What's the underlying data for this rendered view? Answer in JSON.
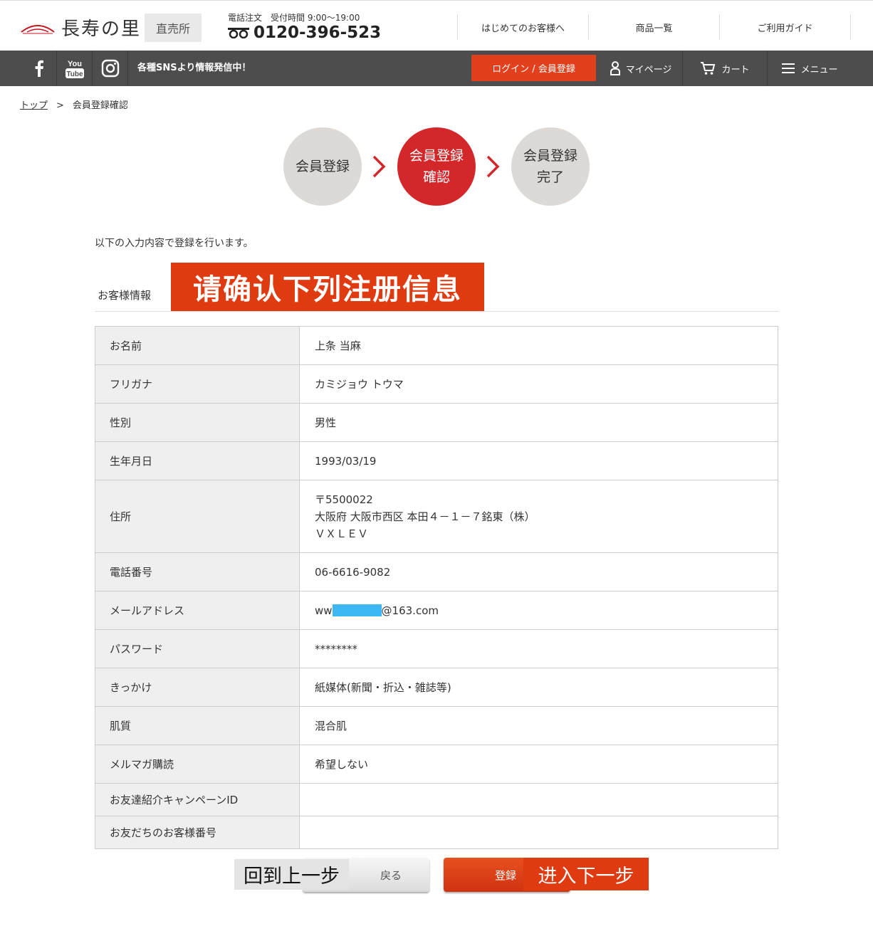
{
  "header": {
    "logo_text": "長寿の里",
    "logo_tag": "直売所",
    "phone_label": "電話注文　受付時間 9:00〜19:00",
    "phone_number": "0120-396-523",
    "nav": [
      "はじめてのお客様へ",
      "商品一覧",
      "ご利用ガイド"
    ]
  },
  "subbar": {
    "sns_text": "各種SNSより情報発信中！",
    "login_label": "ログイン / 会員登録",
    "mypage_label": "マイページ",
    "cart_label": "カート",
    "menu_label": "メニュー",
    "icons": [
      "facebook-icon",
      "youtube-icon",
      "instagram-icon",
      "user-icon",
      "cart-icon",
      "menu-icon"
    ]
  },
  "breadcrumb": {
    "home": "トップ",
    "sep": ">",
    "current": "会員登録確認"
  },
  "steps": [
    {
      "line1": "会員登録",
      "line2": ""
    },
    {
      "line1": "会員登録",
      "line2": "確認"
    },
    {
      "line1": "会員登録",
      "line2": "完了"
    }
  ],
  "intro": "以下の入力内容で登録を行います。",
  "section": {
    "label": "お客様情報",
    "banner": "请确认下列注册信息"
  },
  "table": {
    "rows": [
      {
        "label": "お名前",
        "value": "上条 当麻"
      },
      {
        "label": "フリガナ",
        "value": "カミジョウ トウマ"
      },
      {
        "label": "性別",
        "value": "男性"
      },
      {
        "label": "生年月日",
        "value": "1993/03/19"
      },
      {
        "label": "住所",
        "lines": [
          "〒5500022",
          "大阪府 大阪市西区 本田４－１－７銘東（株）",
          "ＶＸＬＥＶ"
        ]
      },
      {
        "label": "電話番号",
        "value": "06-6616-9082"
      },
      {
        "label": "メールアドレス",
        "email_prefix": "ww",
        "email_suffix": "@163.com"
      },
      {
        "label": "パスワード",
        "value": "********"
      },
      {
        "label": "きっかけ",
        "value": "紙媒体(新聞・折込・雑誌等)"
      },
      {
        "label": "肌質",
        "value": "混合肌"
      },
      {
        "label": "メルマガ購読",
        "value": "希望しない"
      },
      {
        "label": "お友達紹介キャンペーンID",
        "value": ""
      },
      {
        "label": "お友だちのお客様番号",
        "value": ""
      }
    ]
  },
  "buttons": {
    "back_label": "戻る",
    "back_overlay": "回到上一步",
    "submit_label": "登録",
    "submit_overlay": "进入下一步"
  },
  "colors": {
    "accent": "#e2401c",
    "step_active": "#d4272a",
    "dark_bar": "#4d4d4d",
    "redaction": "#3db8f5"
  }
}
